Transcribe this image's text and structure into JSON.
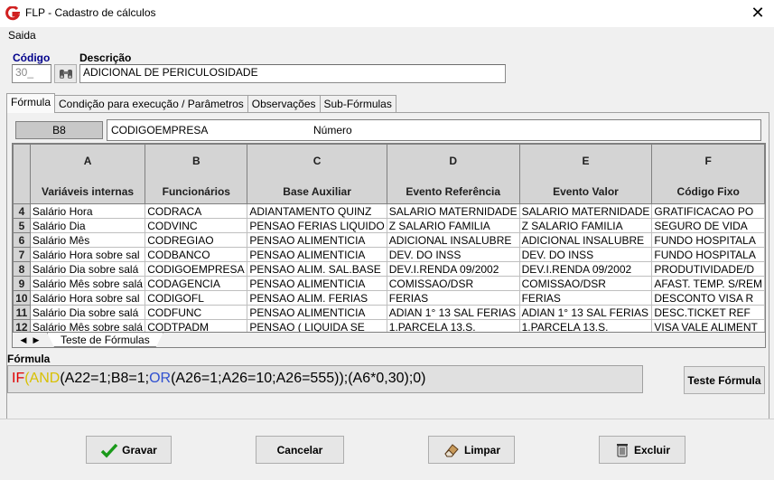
{
  "window": {
    "title": "FLP - Cadastro de cálculos",
    "close_label": "✕"
  },
  "menu": {
    "saida": "Saida"
  },
  "form": {
    "codigo_label": "Código",
    "codigo_value": "30_",
    "descricao_label": "Descrição",
    "descricao_value": "ADICIONAL DE PERICULOSIDADE"
  },
  "tabs": [
    "Fórmula",
    "Condição para execução / Parâmetros",
    "Observações",
    "Sub-Fórmulas"
  ],
  "cell": {
    "ref": "B8",
    "content": "CODIGOEMPRESA",
    "type": "Número"
  },
  "sheet": {
    "columns": [
      {
        "letter": "A",
        "header": "Variáveis internas"
      },
      {
        "letter": "B",
        "header": "Funcionários"
      },
      {
        "letter": "C",
        "header": "Base Auxiliar"
      },
      {
        "letter": "D",
        "header": "Evento Referência"
      },
      {
        "letter": "E",
        "header": "Evento Valor"
      },
      {
        "letter": "F",
        "header": "Código Fixo"
      }
    ],
    "rows": [
      {
        "num": "4",
        "cells": [
          "Salário Hora",
          "CODRACA",
          "ADIANTAMENTO QUINZ",
          "SALARIO MATERNIDADE",
          "SALARIO MATERNIDADE",
          "GRATIFICACAO PO"
        ]
      },
      {
        "num": "5",
        "cells": [
          "Salário Dia",
          "CODVINC",
          "PENSAO FERIAS LIQUIDO",
          "Z SALARIO FAMILIA",
          "Z SALARIO FAMILIA",
          "SEGURO DE VIDA"
        ]
      },
      {
        "num": "6",
        "cells": [
          "Salário Mês",
          "CODREGIAO",
          "PENSAO ALIMENTICIA",
          "ADICIONAL INSALUBRE",
          "ADICIONAL INSALUBRE",
          "FUNDO HOSPITALA"
        ]
      },
      {
        "num": "7",
        "cells": [
          "Salário Hora sobre sal",
          "CODBANCO",
          "PENSAO ALIMENTICIA",
          "DEV. DO INSS",
          "DEV. DO INSS",
          "FUNDO HOSPITALA"
        ]
      },
      {
        "num": "8",
        "cells": [
          "Salário Dia sobre salá",
          "CODIGOEMPRESA",
          "PENSAO ALIM. SAL.BASE",
          "DEV.I.RENDA 09/2002",
          "DEV.I.RENDA 09/2002",
          "PRODUTIVIDADE/D"
        ]
      },
      {
        "num": "9",
        "cells": [
          "Salário Mês sobre salá",
          "CODAGENCIA",
          "PENSAO ALIMENTICIA",
          "COMISSAO/DSR",
          "COMISSAO/DSR",
          "AFAST. TEMP. S/REM"
        ]
      },
      {
        "num": "10",
        "cells": [
          "Salário Hora sobre sal",
          "CODIGOFL",
          "PENSAO ALIM. FERIAS",
          "FERIAS",
          "FERIAS",
          "DESCONTO VISA R"
        ]
      },
      {
        "num": "11",
        "cells": [
          "Salário Dia sobre salá",
          "CODFUNC",
          "PENSAO ALIMENTICIA",
          "ADIAN 1° 13 SAL  FERIAS",
          "ADIAN 1° 13 SAL  FERIAS",
          "DESC.TICKET REF"
        ]
      },
      {
        "num": "12",
        "cells": [
          "Salário Mês sobre salá",
          "CODTPADM",
          "PENSAO ( LIQUIDA SE",
          "1.PARCELA 13.S.",
          "1.PARCELA 13.S.",
          "VISA VALE ALIMENT"
        ]
      }
    ],
    "sheet_tab": "Teste de Fórmulas"
  },
  "formula": {
    "label": "Fórmula",
    "parts": {
      "if": "IF",
      "p1": "(",
      "and": "AND",
      "p2": "(A22=1;B8=1;",
      "or": "OR",
      "p3": "(A26=1;A26=10;A26=555));(A6*0,30);0)"
    },
    "test_button": "Teste Fórmula"
  },
  "buttons": {
    "gravar": "Gravar",
    "cancelar": "Cancelar",
    "limpar": "Limpar",
    "excluir": "Excluir"
  },
  "colors": {
    "check_green": "#1a9a1a",
    "codigo_label": "#00008b",
    "if_red": "#e00000",
    "and_yellow": "#d8c000",
    "or_blue": "#3050d0"
  },
  "icons": [
    "app-logo-icon",
    "binoculars-icon",
    "checkmark-icon",
    "eraser-icon",
    "trash-icon",
    "close-icon"
  ]
}
